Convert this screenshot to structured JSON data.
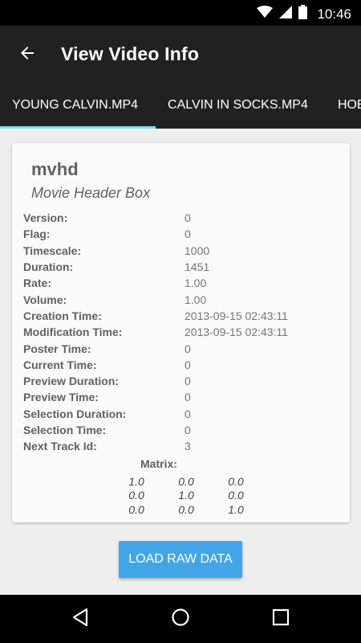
{
  "status_bar": {
    "time": "10:46",
    "icons": [
      "wifi-icon",
      "cellular-signal-icon",
      "battery-icon"
    ]
  },
  "app_bar": {
    "title": "View Video Info",
    "back_icon": "arrow-back-icon"
  },
  "tabs": [
    {
      "label": "YOUNG CALVIN.MP4",
      "selected": true
    },
    {
      "label": "CALVIN IN SOCKS.MP4",
      "selected": false
    },
    {
      "label": "HOB",
      "selected": false
    }
  ],
  "card": {
    "box_name": "mvhd",
    "box_description": "Movie Header Box",
    "fields": [
      {
        "label": "Version:",
        "value": "0"
      },
      {
        "label": "Flag:",
        "value": "0"
      },
      {
        "label": "Timescale:",
        "value": "1000"
      },
      {
        "label": "Duration:",
        "value": "1451"
      },
      {
        "label": "Rate:",
        "value": "1.00"
      },
      {
        "label": "Volume:",
        "value": "1.00"
      },
      {
        "label": "Creation Time:",
        "value": "2013-09-15 02:43:11"
      },
      {
        "label": "Modification Time:",
        "value": "2013-09-15 02:43:11"
      },
      {
        "label": "Poster Time:",
        "value": "0"
      },
      {
        "label": "Current Time:",
        "value": "0"
      },
      {
        "label": "Preview Duration:",
        "value": "0"
      },
      {
        "label": "Preview Time:",
        "value": "0"
      },
      {
        "label": "Selection Duration:",
        "value": "0"
      },
      {
        "label": "Selection Time:",
        "value": "0"
      },
      {
        "label": "Next Track Id:",
        "value": "3"
      }
    ],
    "matrix_label": "Matrix:",
    "matrix": [
      [
        "1.0",
        "0.0",
        "0.0"
      ],
      [
        "0.0",
        "1.0",
        "0.0"
      ],
      [
        "0.0",
        "0.0",
        "1.0"
      ]
    ]
  },
  "load_raw_button": "LOAD RAW DATA",
  "nav_bar": {
    "buttons": [
      "back-triangle-icon",
      "home-circle-icon",
      "recents-square-icon"
    ]
  },
  "colors": {
    "app_bar": "#212121",
    "tab_indicator": "#80deea",
    "button": "#42a5e8",
    "background": "#eeeeee"
  }
}
